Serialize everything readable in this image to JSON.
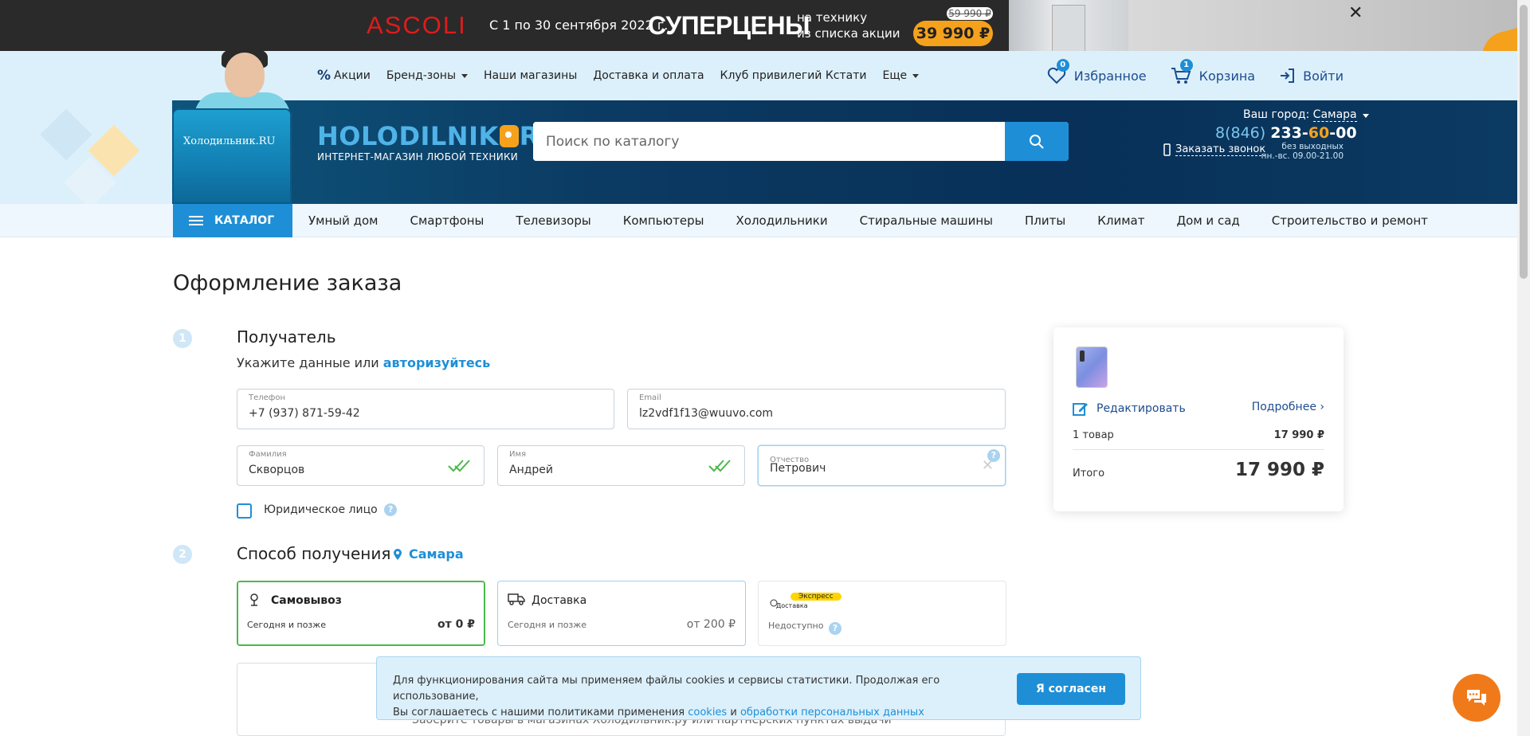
{
  "promo": {
    "brand": "ASCOLI",
    "dates": "С 1 по 30 сентября 2022 г.",
    "title": "СУПЕРЦЕНЫ",
    "sub_line1": "на технику",
    "sub_line2": "из списка акции",
    "old_price": "59 990 ₽",
    "price": "39 990 ₽",
    "close_icon": "close-icon"
  },
  "topnav": {
    "links": [
      "Акции",
      "Бренд-зоны",
      "Наши магазины",
      "Доставка и оплата",
      "Клуб привилегий Кстати",
      "Еще"
    ],
    "favorites_label": "Избранное",
    "favorites_count": "0",
    "cart_label": "Корзина",
    "cart_count": "1",
    "login_label": "Войти"
  },
  "header": {
    "mascot_text": "Холодильник.RU",
    "logo_part1": "HOLODILNIK",
    "logo_part2": "RU",
    "logo_sub": "ИНТЕРНЕТ-МАГАЗИН ЛЮБОЙ ТЕХНИКИ",
    "search_placeholder": "Поиск по каталогу",
    "city_prefix": "Ваш город:",
    "city": "Самара",
    "phone_code": "8(846)",
    "phone_a": "233-",
    "phone_b": "60",
    "phone_c": "-00",
    "callback": "Заказать звонок",
    "hours_line1": "без выходных",
    "hours_line2": "пн.-вс. 09.00-21.00"
  },
  "catalog": {
    "button": "КАТАЛОГ",
    "links": [
      "Умный дом",
      "Смартфоны",
      "Телевизоры",
      "Компьютеры",
      "Холодильники",
      "Стиральные машины",
      "Плиты",
      "Климат",
      "Дом и сад",
      "Строительство и ремонт"
    ]
  },
  "order": {
    "title": "Оформление заказа",
    "step1_num": "1",
    "step1_title": "Получатель",
    "step1_sub": "Укажите данные или",
    "step1_sub_link": "авторизуйтесь",
    "phone_label": "Телефон",
    "phone_value": "+7 (937) 871-59-42",
    "email_label": "Email",
    "email_value": "lz2vdf1f13@wuuvo.com",
    "lastname_label": "Фамилия",
    "lastname_value": "Скворцов",
    "firstname_label": "Имя",
    "firstname_value": "Андрей",
    "patronymic_label": "Отчество",
    "patronymic_value": "Петрович",
    "legal_label": "Юридическое лицо",
    "step2_num": "2",
    "step2_title": "Способ получения",
    "step2_city": "Самара",
    "pickup_title": "Самовывоз",
    "pickup_sub": "Сегодня и позже",
    "pickup_price": "от 0 ₽",
    "delivery_title": "Доставка",
    "delivery_sub": "Сегодня и позже",
    "delivery_price": "от 200 ₽",
    "express_badge": "Экспресс",
    "express_title": "Доставка",
    "express_sub": "Недоступно",
    "map_text": "Заберите товары в магазинах Холодильник.ру или партнерских пунктах выдачи"
  },
  "summary": {
    "edit": "Редактировать",
    "more": "Подробнее ›",
    "items_label": "1 товар",
    "items_value": "17 990 ₽",
    "total_label": "Итого",
    "total_value": "17 990 ₽"
  },
  "cookie": {
    "line1": "Для функционирования сайта мы применяем файлы cookies и сервисы статистики. Продолжая его использование,",
    "line2": "Вы соглашаетесь с нашими политиками применения",
    "link1": "cookies",
    "and": "и",
    "link2": "обработки персональных данных",
    "button": "Я согласен"
  },
  "colors": {
    "accent": "#1e8fd6",
    "header_dark": "#0b3a62",
    "orange": "#f5a11c",
    "green_check": "#4cb84a"
  }
}
